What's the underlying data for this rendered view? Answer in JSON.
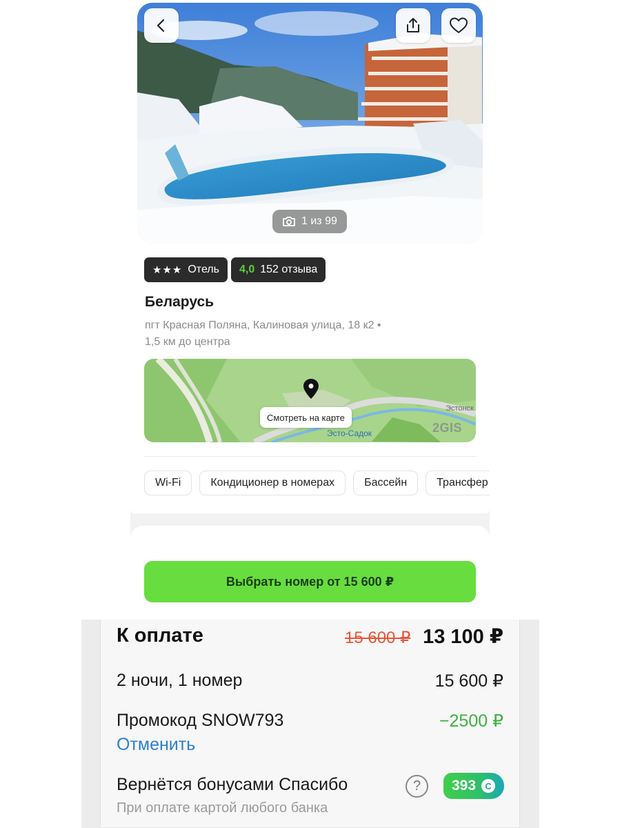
{
  "photo": {
    "counter": "1 из 99",
    "icons": {
      "back": "chevron-left-icon",
      "share": "share-icon",
      "favorite": "heart-icon",
      "camera": "camera-icon"
    }
  },
  "badges": {
    "stars": "★★★",
    "type": "Отель",
    "rating": "4,0",
    "reviews": "152 отзыва"
  },
  "hotel": {
    "name": "Беларусь",
    "address": "пгт Красная Поляна, Калиновая улица, 18 к2 •",
    "distance": "1,5 км до центра"
  },
  "map": {
    "button_label": "Смотреть на карте",
    "place_label": "Эсто-Садок",
    "road_label": "Эстонск",
    "logo": "2GIS"
  },
  "amenities": [
    "Wi-Fi",
    "Кондиционер в номерах",
    "Бассейн",
    "Трансфер"
  ],
  "cta": {
    "label": "Выбрать номер от 15 600 ₽"
  },
  "payment": {
    "title": "К оплате",
    "old_price": "15 600 ₽",
    "new_price": "13 100 ₽",
    "nights_label": "2 ночи, 1 номер",
    "nights_value": "15 600 ₽",
    "promo_label": "Промокод SNOW793",
    "promo_value": "−2500 ₽",
    "cancel_label": "Отменить",
    "bonus_label": "Вернётся бонусами Спасибо",
    "bonus_sub": "При оплате картой любого банка",
    "help": "?",
    "bonus_amount": "393",
    "bonus_coin": "C"
  },
  "colors": {
    "accent_green": "#68dd3f",
    "rating_green": "#5ad13b",
    "old_price_red": "#e8543a",
    "promo_green": "#3db23d",
    "link_blue": "#2b7fd0"
  }
}
